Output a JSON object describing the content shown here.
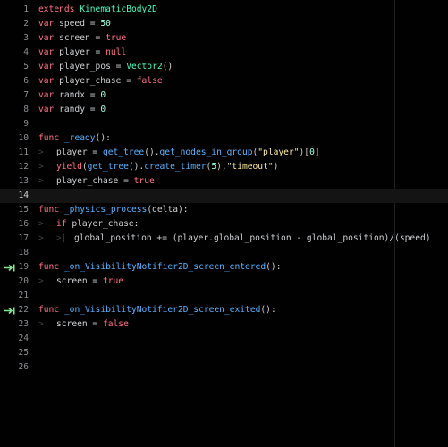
{
  "colors": {
    "background": "#010101",
    "keyword": "#ff7085",
    "class_name": "#42ffc2",
    "number": "#a1ffe0",
    "string": "#ffeda1",
    "function": "#57b3ff",
    "text": "#cdcfd2",
    "line_number": "#8a8d92",
    "signal_icon": "#7ee78f"
  },
  "lines": [
    {
      "n": "1",
      "tokens": [
        {
          "t": "extends",
          "c": "kw"
        },
        {
          "t": " ",
          "c": "plain"
        },
        {
          "t": "KinematicBody2D",
          "c": "cls"
        }
      ]
    },
    {
      "n": "2",
      "tokens": [
        {
          "t": "var",
          "c": "kw"
        },
        {
          "t": " speed = ",
          "c": "plain"
        },
        {
          "t": "50",
          "c": "num-lit"
        }
      ]
    },
    {
      "n": "3",
      "tokens": [
        {
          "t": "var",
          "c": "kw"
        },
        {
          "t": " screen = ",
          "c": "plain"
        },
        {
          "t": "true",
          "c": "kw"
        }
      ]
    },
    {
      "n": "4",
      "tokens": [
        {
          "t": "var",
          "c": "kw"
        },
        {
          "t": " player = ",
          "c": "plain"
        },
        {
          "t": "null",
          "c": "kw"
        }
      ]
    },
    {
      "n": "5",
      "tokens": [
        {
          "t": "var",
          "c": "kw"
        },
        {
          "t": " player_pos = ",
          "c": "plain"
        },
        {
          "t": "Vector2",
          "c": "cls"
        },
        {
          "t": "()",
          "c": "plain"
        }
      ]
    },
    {
      "n": "6",
      "tokens": [
        {
          "t": "var",
          "c": "kw"
        },
        {
          "t": " player_chase = ",
          "c": "plain"
        },
        {
          "t": "false",
          "c": "kw"
        }
      ]
    },
    {
      "n": "7",
      "tokens": [
        {
          "t": "var",
          "c": "kw"
        },
        {
          "t": " randx = ",
          "c": "plain"
        },
        {
          "t": "0",
          "c": "num-lit"
        }
      ]
    },
    {
      "n": "8",
      "tokens": [
        {
          "t": "var",
          "c": "kw"
        },
        {
          "t": " randy = ",
          "c": "plain"
        },
        {
          "t": "0",
          "c": "num-lit"
        }
      ]
    },
    {
      "n": "9",
      "tokens": []
    },
    {
      "n": "10",
      "tokens": [
        {
          "t": "func",
          "c": "kw"
        },
        {
          "t": " ",
          "c": "plain"
        },
        {
          "t": "_ready",
          "c": "fn"
        },
        {
          "t": "():",
          "c": "plain"
        }
      ]
    },
    {
      "n": "11",
      "indent": 1,
      "tokens": [
        {
          "t": "player = ",
          "c": "plain"
        },
        {
          "t": "get_tree",
          "c": "fn"
        },
        {
          "t": "().",
          "c": "plain"
        },
        {
          "t": "get_nodes_in_group",
          "c": "fn"
        },
        {
          "t": "(",
          "c": "plain"
        },
        {
          "t": "\"player\"",
          "c": "str"
        },
        {
          "t": ")[",
          "c": "plain"
        },
        {
          "t": "0",
          "c": "num-lit"
        },
        {
          "t": "]",
          "c": "plain"
        }
      ]
    },
    {
      "n": "12",
      "indent": 1,
      "tokens": [
        {
          "t": "yield",
          "c": "kw"
        },
        {
          "t": "(",
          "c": "plain"
        },
        {
          "t": "get_tree",
          "c": "fn"
        },
        {
          "t": "().",
          "c": "plain"
        },
        {
          "t": "create_timer",
          "c": "fn"
        },
        {
          "t": "(",
          "c": "plain"
        },
        {
          "t": "5",
          "c": "num-lit"
        },
        {
          "t": "),",
          "c": "plain"
        },
        {
          "t": "\"timeout\"",
          "c": "str"
        },
        {
          "t": ")",
          "c": "plain"
        }
      ]
    },
    {
      "n": "13",
      "indent": 1,
      "tokens": [
        {
          "t": "player_chase = ",
          "c": "plain"
        },
        {
          "t": "true",
          "c": "kw"
        }
      ]
    },
    {
      "n": "14",
      "current": true,
      "tokens": []
    },
    {
      "n": "15",
      "tokens": [
        {
          "t": "func",
          "c": "kw"
        },
        {
          "t": " ",
          "c": "plain"
        },
        {
          "t": "_physics_process",
          "c": "fn"
        },
        {
          "t": "(delta):",
          "c": "plain"
        }
      ]
    },
    {
      "n": "16",
      "indent": 1,
      "tokens": [
        {
          "t": "if",
          "c": "kw"
        },
        {
          "t": " player_chase:",
          "c": "plain"
        }
      ]
    },
    {
      "n": "17",
      "indent": 2,
      "tokens": [
        {
          "t": "global_position += (player.global_position - global_position)/(speed)",
          "c": "plain"
        }
      ]
    },
    {
      "n": "18",
      "tokens": []
    },
    {
      "n": "19",
      "signal": true,
      "tokens": [
        {
          "t": "func",
          "c": "kw"
        },
        {
          "t": " ",
          "c": "plain"
        },
        {
          "t": "_on_VisibilityNotifier2D_screen_entered",
          "c": "fn"
        },
        {
          "t": "():",
          "c": "plain"
        }
      ]
    },
    {
      "n": "20",
      "indent": 1,
      "tokens": [
        {
          "t": "screen = ",
          "c": "plain"
        },
        {
          "t": "true",
          "c": "kw"
        }
      ]
    },
    {
      "n": "21",
      "tokens": []
    },
    {
      "n": "22",
      "signal": true,
      "tokens": [
        {
          "t": "func",
          "c": "kw"
        },
        {
          "t": " ",
          "c": "plain"
        },
        {
          "t": "_on_VisibilityNotifier2D_screen_exited",
          "c": "fn"
        },
        {
          "t": "():",
          "c": "plain"
        }
      ]
    },
    {
      "n": "23",
      "indent": 1,
      "tokens": [
        {
          "t": "screen = ",
          "c": "plain"
        },
        {
          "t": "false",
          "c": "kw"
        }
      ]
    },
    {
      "n": "24",
      "tokens": []
    },
    {
      "n": "25",
      "tokens": []
    },
    {
      "n": "26",
      "tokens": []
    }
  ],
  "icons": {
    "tab": "tab-indent-icon",
    "signal": "signal-connection-icon"
  }
}
